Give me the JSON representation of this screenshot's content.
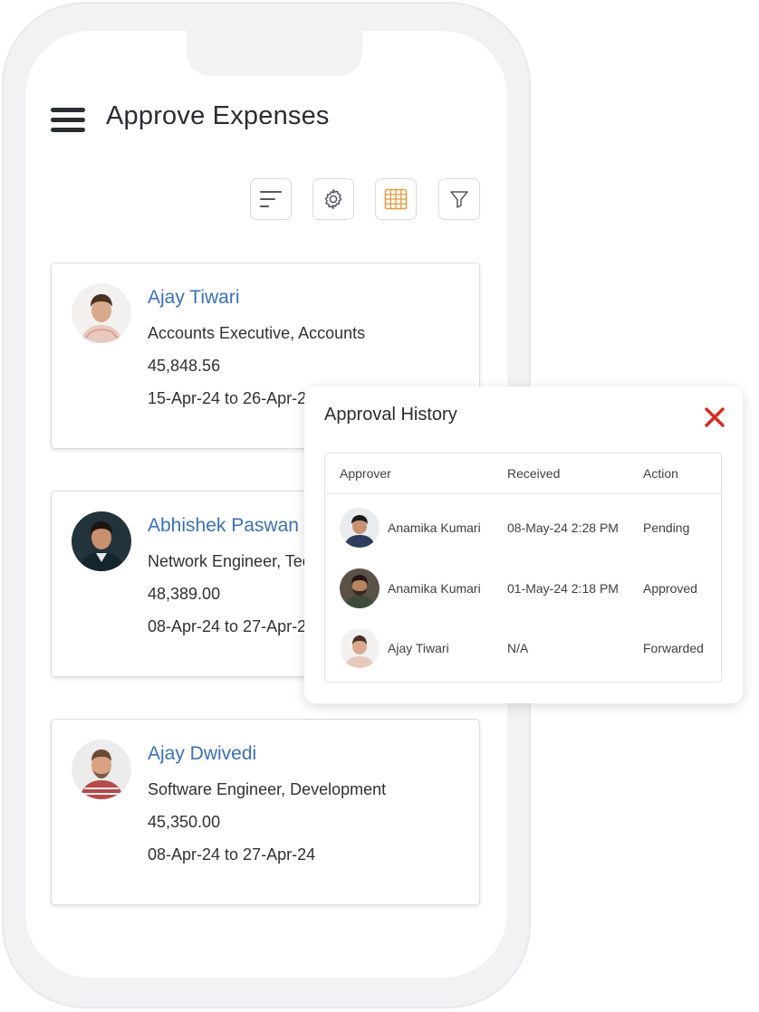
{
  "header": {
    "title": "Approve Expenses"
  },
  "toolbar": {
    "icons": [
      "sort-icon",
      "gear-icon",
      "grid-icon",
      "filter-icon"
    ],
    "grid_accent": "#e89a3c"
  },
  "cards": [
    {
      "name": "Ajay Tiwari",
      "role": "Accounts Executive, Accounts",
      "amount": "45,848.56",
      "period": "15-Apr-24 to 26-Apr-24"
    },
    {
      "name": "Abhishek Paswan",
      "role": "Network Engineer, Technology",
      "amount": "48,389.00",
      "period": "08-Apr-24 to 27-Apr-24"
    },
    {
      "name": "Ajay Dwivedi",
      "role": "Software Engineer, Development",
      "amount": "45,350.00",
      "period": "08-Apr-24 to 27-Apr-24"
    }
  ],
  "popup": {
    "title": "Approval History",
    "columns": [
      "Approver",
      "Received",
      "Action"
    ],
    "rows": [
      {
        "approver": "Anamika Kumari",
        "received": "08-May-24 2:28 PM",
        "action": "Pending"
      },
      {
        "approver": "Anamika Kumari",
        "received": "01-May-24 2:18 PM",
        "action": "Approved"
      },
      {
        "approver": "Ajay Tiwari",
        "received": "N/A",
        "action": "Forwarded"
      }
    ]
  },
  "colors": {
    "name_link": "#3a6fbf",
    "close_red": "#e0261b"
  }
}
